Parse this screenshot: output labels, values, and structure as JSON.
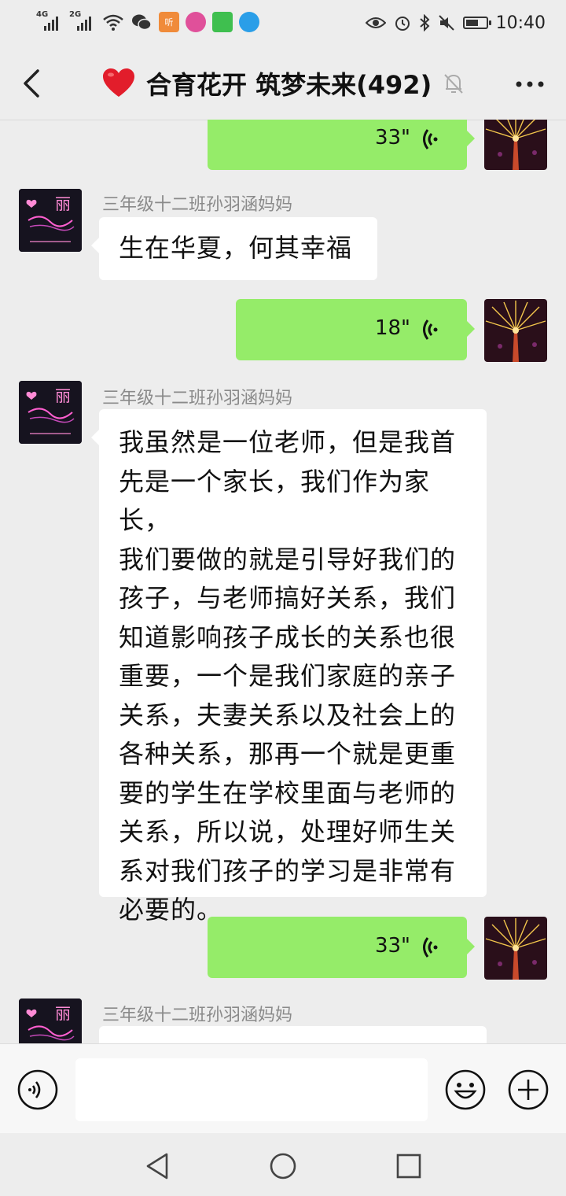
{
  "status_bar": {
    "net1": "4G",
    "net2": "2G",
    "app_badge_1": "听",
    "time": "10:40",
    "icons": [
      "signal-icon",
      "wifi-icon",
      "wechat-icon",
      "app-icon",
      "eye-icon",
      "alarm-icon",
      "bluetooth-icon",
      "mute-icon",
      "battery-icon"
    ]
  },
  "header": {
    "emoji": "❤️",
    "title": "合育花开 筑梦未来(492)",
    "icons": [
      "back-icon",
      "mute-bell-icon",
      "more-icon"
    ]
  },
  "messages": [
    {
      "type": "voice",
      "from": "me",
      "duration": "33\""
    },
    {
      "type": "text",
      "from": "other",
      "sender": "三年级十二班孙羽涵妈妈",
      "lines": [
        "生在华夏，何其幸福"
      ]
    },
    {
      "type": "voice",
      "from": "me",
      "duration": "18\""
    },
    {
      "type": "text",
      "from": "other",
      "sender": "三年级十二班孙羽涵妈妈",
      "lines": [
        "我虽然是一位老师，但是我首",
        "先是一个家长，我们作为家长，",
        "我们要做的就是引导好我们的",
        "孩子，与老师搞好关系，我们",
        "知道影响孩子成长的关系也很",
        "重要，一个是我们家庭的亲子",
        "关系，夫妻关系以及社会上的",
        "各种关系，那再一个就是更重",
        "要的学生在学校里面与老师的",
        "关系，所以说，处理好师生关",
        "系对我们孩子的学习是非常有",
        "必要的。"
      ]
    },
    {
      "type": "voice",
      "from": "me",
      "duration": "33\""
    },
    {
      "type": "text",
      "from": "other",
      "sender": "三年级十二班孙羽涵妈妈",
      "lines": []
    }
  ],
  "avatar_other": {
    "char": "丽"
  },
  "input_bar": {
    "value": "",
    "icons": [
      "voice-input-icon",
      "emoji-icon",
      "plus-icon"
    ]
  },
  "nav_bar": {
    "icons": [
      "nav-back-icon",
      "nav-home-icon",
      "nav-recent-icon"
    ]
  },
  "colors": {
    "bg": "#ededed",
    "my_bubble": "#95ec69",
    "their_bubble": "#ffffff",
    "sender_gray": "#8a8a8a"
  }
}
